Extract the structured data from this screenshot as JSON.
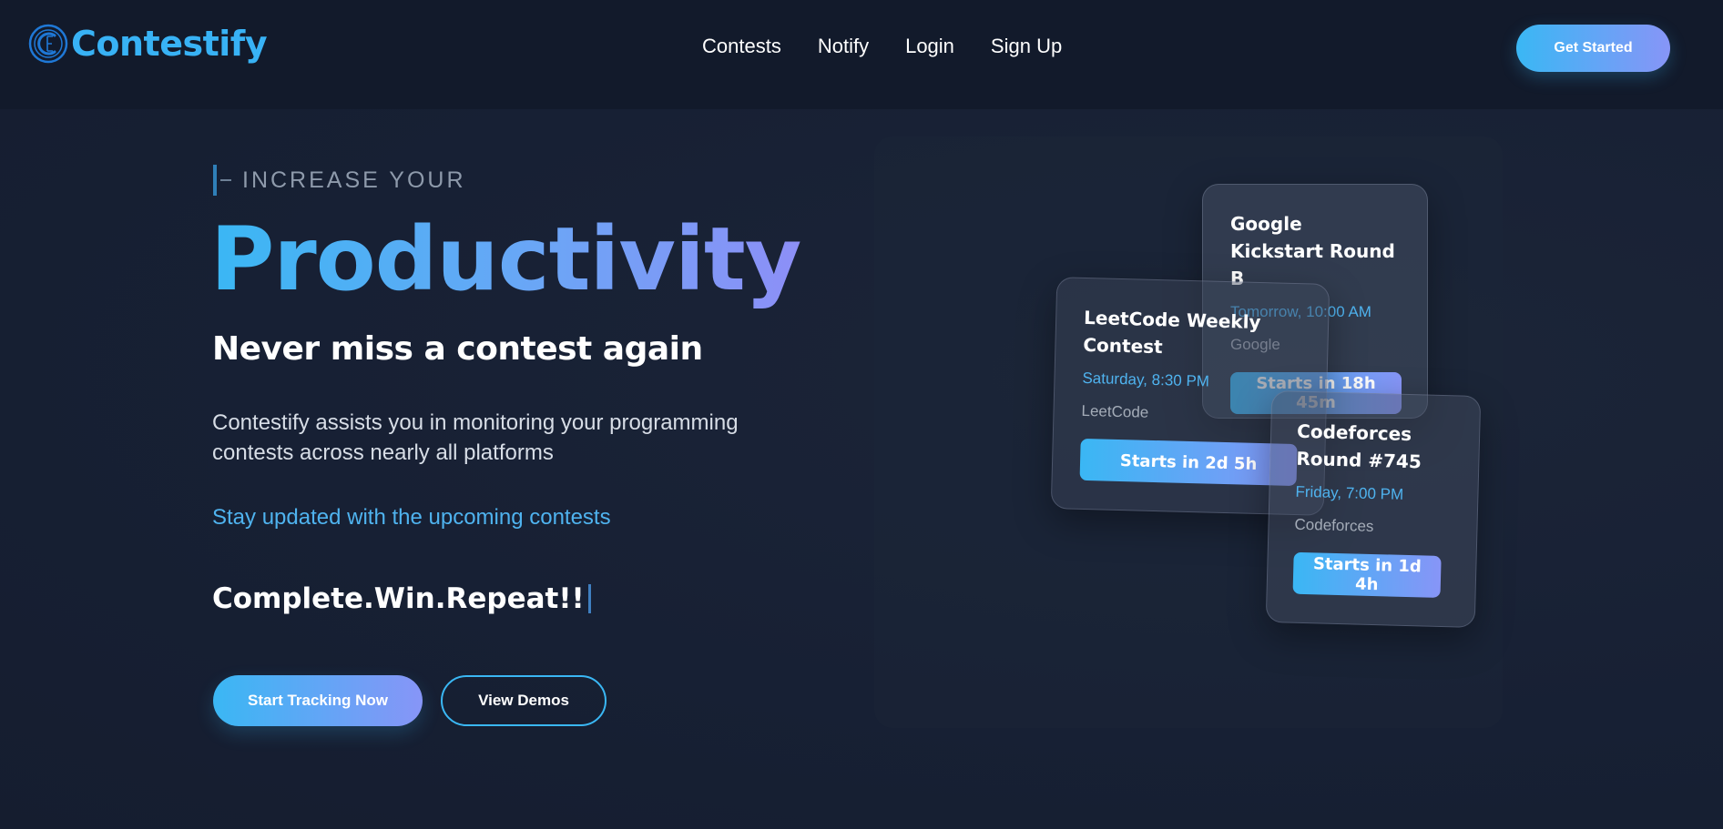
{
  "app": {
    "logo_text": "Contestify",
    "logo_icon": "c-gear-logo-icon"
  },
  "nav": {
    "links": [
      "Contests",
      "Notify",
      "Login",
      "Sign Up"
    ],
    "cta_label": "Get Started"
  },
  "hero": {
    "eyebrow": "INCREASE YOUR",
    "headline": "Productivity",
    "subhead": "Never miss a contest again",
    "description": "Contestify assists you in monitoring your programming contests across nearly all platforms",
    "stay_updated": "Stay updated with the upcoming contests",
    "tagline": "Complete.Win.Repeat!!",
    "primary_button": "Start Tracking Now",
    "secondary_button": "View Demos"
  },
  "cards": [
    {
      "title": "Google Kickstart Round B",
      "time": "Tomorrow, 10:00 AM",
      "platform": "Google",
      "countdown": "Starts in 18h 45m"
    },
    {
      "title": "LeetCode Weekly Contest",
      "time": "Saturday, 8:30 PM",
      "platform": "LeetCode",
      "countdown": "Starts in 2d 5h"
    },
    {
      "title": "Codeforces Round #745",
      "time": "Friday, 7:00 PM",
      "platform": "Codeforces",
      "countdown": "Starts in 1d 4h"
    }
  ],
  "colors": {
    "background": "#182033",
    "navbar": "#121a2b",
    "accent_blue": "#3ab7f4",
    "accent_violet": "#8795f7",
    "link_blue": "#4fb3ef"
  }
}
